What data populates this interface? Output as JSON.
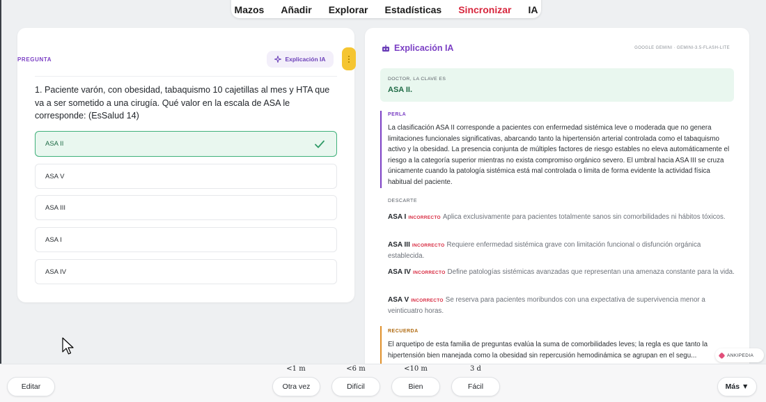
{
  "nav": {
    "items": [
      "Mazos",
      "Añadir",
      "Explorar",
      "Estadísticas",
      "Sincronizar",
      "IA"
    ],
    "active_color": "#d7263d"
  },
  "question": {
    "label": "PREGUNTA",
    "ia_button": "Explicación IA",
    "text": "1. Paciente varón, con obesidad, tabaquismo 10 cajetillas al mes y HTA que va a ser sometido a una cirugía. Qué valor en la escala de ASA le corresponde: (EsSalud 14)",
    "options": [
      "ASA II",
      "ASA V",
      "ASA III",
      "ASA I",
      "ASA IV"
    ],
    "correct_index": 0
  },
  "explanation": {
    "title": "Explicación IA",
    "model": "GOOGLE GEMINI · GEMINI-3.5-FLASH-LITE",
    "answer_label": "DOCTOR, LA CLAVE ES",
    "answer_value": "ASA II.",
    "perla_label": "PERLA",
    "perla_text": "La clasificación ASA II corresponde a pacientes con enfermedad sistémica leve o moderada que no genera limitaciones funcionales significativas, abarcando tanto la hipertensión arterial controlada como el tabaquismo activo y la obesidad. La presencia conjunta de múltiples factores de riesgo estables no eleva automáticamente el riesgo a la categoría superior mientras no exista compromiso orgánico severo. El umbral hacia ASA III se cruza únicamente cuando la patología sistémica está mal controlada o limita de forma evidente la actividad física habitual del paciente.",
    "descarte_label": "DESCARTE",
    "incorrect_tag": "INCORRECTO",
    "discards": [
      {
        "option": "ASA I",
        "text": "Aplica exclusivamente para pacientes totalmente sanos sin comorbilidades ni hábitos tóxicos."
      },
      {
        "option": "ASA III",
        "text": "Requiere enfermedad sistémica grave con limitación funcional o disfunción orgánica establecida."
      },
      {
        "option": "ASA IV",
        "text": "Define patologías sistémicas avanzadas que representan una amenaza constante para la vida."
      },
      {
        "option": "ASA V",
        "text": "Se reserva para pacientes moribundos con una expectativa de supervivencia menor a veinticuatro horas."
      }
    ],
    "recuerda_label": "RECUERDA",
    "recuerda_text": "El arquetipo de esta familia de preguntas evalúa la suma de comorbilidades leves; la regla es que tanto la hipertensión bien manejada como la obesidad sin repercusión hemodinámica se agrupan en el segu..."
  },
  "badge": "ANKIPEDIA",
  "bottom": {
    "edit": "Editar",
    "times": [
      "<1 m",
      "<6 m",
      "<10 m",
      "3 d"
    ],
    "answers": [
      "Otra vez",
      "Difícil",
      "Bien",
      "Fácil"
    ],
    "more": "Más ▼"
  }
}
